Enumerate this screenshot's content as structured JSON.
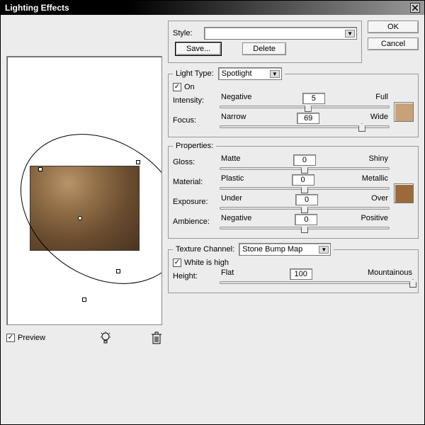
{
  "title": "Lighting Effects",
  "buttons": {
    "ok": "OK",
    "cancel": "Cancel",
    "save": "Save...",
    "delete": "Delete"
  },
  "style": {
    "label": "Style:",
    "value": ""
  },
  "preview": {
    "label": "Preview",
    "checked": true
  },
  "lightType": {
    "legend": "Light Type:",
    "value": "Spotlight",
    "onLabel": "On",
    "onChecked": true,
    "intensity": {
      "label": "Intensity:",
      "left": "Negative",
      "right": "Full",
      "value": "5",
      "pos": 52
    },
    "focus": {
      "label": "Focus:",
      "left": "Narrow",
      "right": "Wide",
      "value": "69",
      "pos": 84
    },
    "color": "#c9a178"
  },
  "properties": {
    "legend": "Properties:",
    "gloss": {
      "label": "Gloss:",
      "left": "Matte",
      "right": "Shiny",
      "value": "0",
      "pos": 50
    },
    "material": {
      "label": "Material:",
      "left": "Plastic",
      "right": "Metallic",
      "value": "0",
      "pos": 50
    },
    "exposure": {
      "label": "Exposure:",
      "left": "Under",
      "right": "Over",
      "value": "0",
      "pos": 50
    },
    "ambience": {
      "label": "Ambience:",
      "left": "Negative",
      "right": "Positive",
      "value": "0",
      "pos": 50
    },
    "color": "#9c6a3a"
  },
  "texture": {
    "legend": "Texture Channel:",
    "value": "Stone Bump Map",
    "whiteHigh": {
      "label": "White is high",
      "checked": true
    },
    "height": {
      "label": "Height:",
      "left": "Flat",
      "right": "Mountainous",
      "value": "100",
      "pos": 100
    }
  }
}
